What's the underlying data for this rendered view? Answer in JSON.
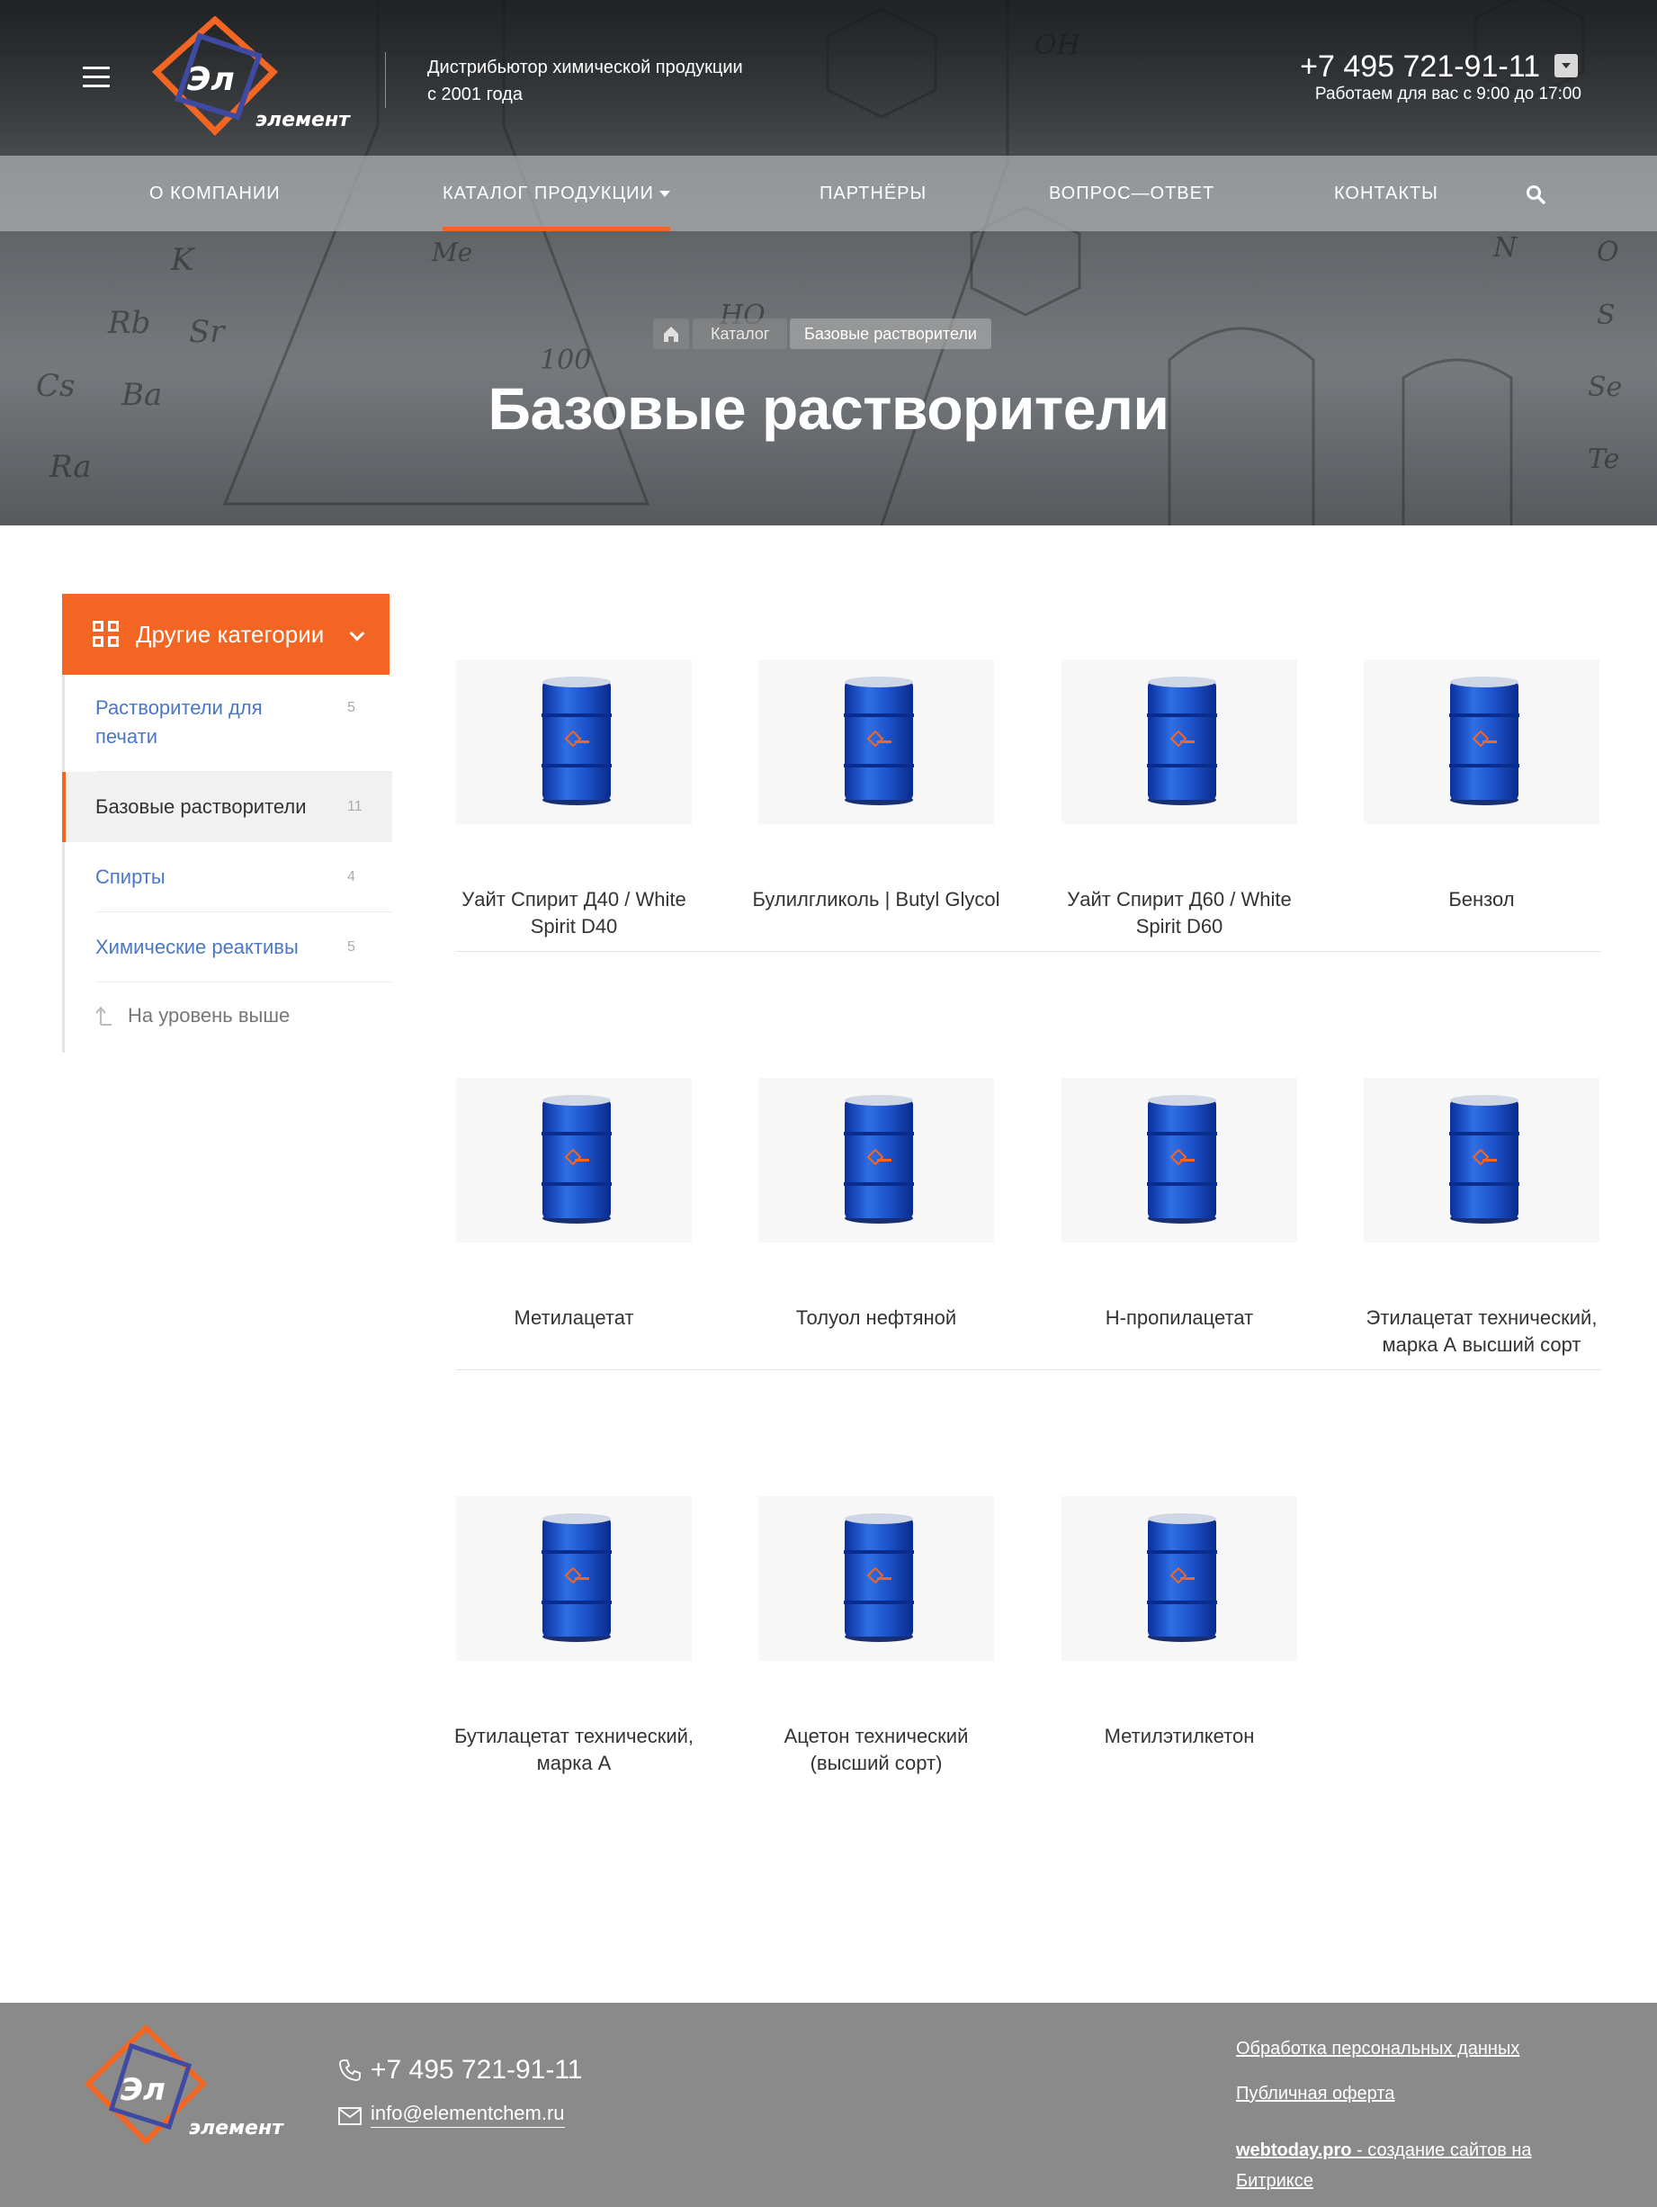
{
  "header": {
    "logo_text_top": "Эл",
    "logo_text_bottom": "элемент",
    "tagline_line1": "Дистрибьютор химической продукции",
    "tagline_line2": "с 2001 года",
    "phone": "+7 495 721-91-11",
    "worktime": "Работаем для вас с 9:00 до 17:00",
    "accent_color": "#f26522"
  },
  "nav": {
    "items": [
      {
        "label": "О компании"
      },
      {
        "label": "Каталог продукции"
      },
      {
        "label": "Партнёры"
      },
      {
        "label": "Вопрос—ответ"
      },
      {
        "label": "Контакты"
      }
    ],
    "active_index": 1
  },
  "breadcrumb": {
    "catalog": "Каталог",
    "current": "Базовые растворители"
  },
  "page_title": "Базовые растворители",
  "sidebar": {
    "header": "Другие категории",
    "items": [
      {
        "label": "Растворители для печати",
        "count": "5"
      },
      {
        "label": "Базовые растворители",
        "count": "11"
      },
      {
        "label": "Спирты",
        "count": "4"
      },
      {
        "label": "Химические реактивы",
        "count": "5"
      }
    ],
    "up_label": "На уровень выше"
  },
  "products": [
    {
      "name": "Уайт Спирит Д40 / White Spirit D40"
    },
    {
      "name": "Булилгликоль | Butyl Glycol"
    },
    {
      "name": "Уайт Спирит Д60 / White Spirit D60"
    },
    {
      "name": "Бензол"
    },
    {
      "name": "Метилацетат"
    },
    {
      "name": "Толуол нефтяной"
    },
    {
      "name": "Н-пропилацетат"
    },
    {
      "name": "Этилацетат технический, марка А высший сорт"
    },
    {
      "name": "Бутилацетат технический, марка А"
    },
    {
      "name": "Ацетон технический (высший сорт)"
    },
    {
      "name": "Метилэтилкетон"
    }
  ],
  "footer": {
    "phone": "+7 495 721-91-11",
    "email": "info@elementchem.ru",
    "links": [
      {
        "label": "Обработка персональных данных"
      },
      {
        "label": "Публичная оферта"
      }
    ],
    "dev_name": "webtoday.pro",
    "dev_text": " - создание сайтов на Битриксе"
  }
}
